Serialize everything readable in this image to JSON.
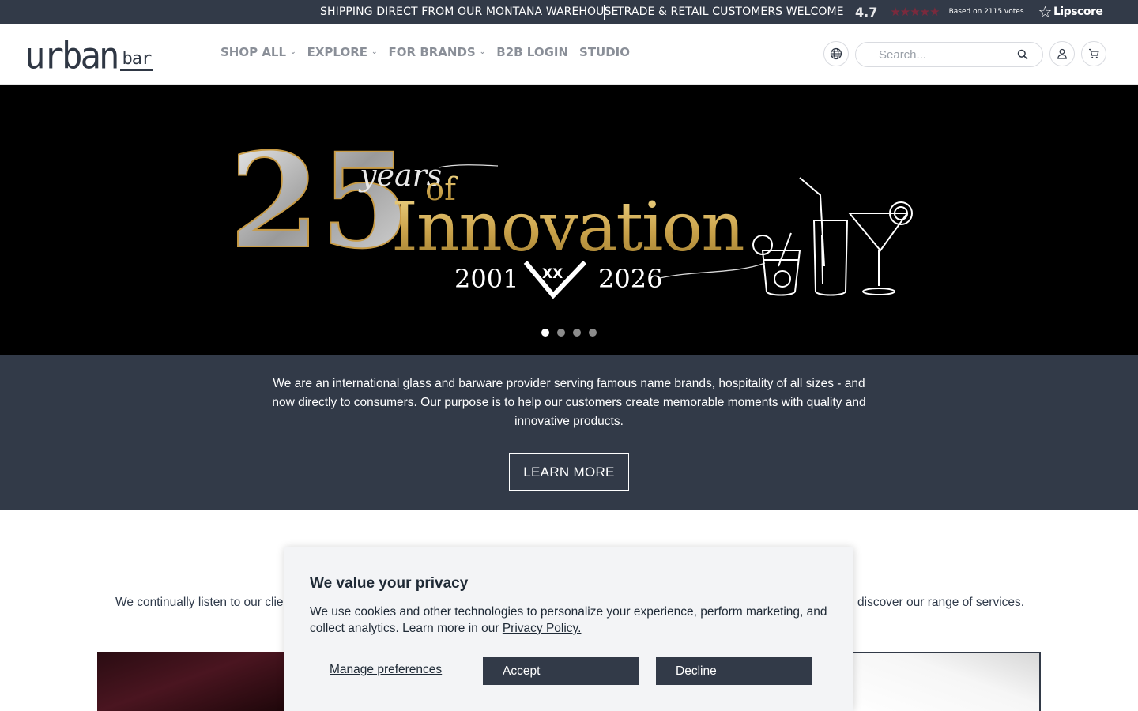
{
  "topbar": {
    "message_1": "SHIPPING DIRECT FROM OUR MONTANA WAREHOUSE",
    "message_2": "TRADE & RETAIL CUSTOMERS WELCOME",
    "rating_score": "4.7",
    "rating_stars": "★★★★★",
    "rating_votes": "Based on 2115 votes",
    "lipscore_brand": "Lipscore",
    "lipscore_star": "☆"
  },
  "header": {
    "logo_word": "urban",
    "logo_bar": "bar",
    "nav": [
      {
        "label": "SHOP ALL",
        "has_dropdown": true,
        "chevron": "⌄"
      },
      {
        "label": "EXPLORE",
        "has_dropdown": true,
        "chevron": "⌄"
      },
      {
        "label": "FOR BRANDS",
        "has_dropdown": true,
        "chevron": "⌄"
      },
      {
        "label": "B2B LOGIN",
        "has_dropdown": false
      },
      {
        "label": "STUDIO",
        "has_dropdown": false
      }
    ],
    "search_placeholder": "Search...",
    "icons": [
      "globe-icon",
      "search-icon",
      "user-icon",
      "cart-icon"
    ]
  },
  "hero": {
    "number": "25",
    "years": "years",
    "of": "of",
    "headline": "Innovation",
    "year_start": "2001",
    "emblem": "XX",
    "year_end": "2026",
    "slides_count": 4,
    "active_slide": 1
  },
  "about": {
    "text": "We are an international glass and barware provider serving famous name brands, hospitality of all sizes - and now directly to consumers. Our purpose is to help our customers create memorable moments with quality and innovative products.",
    "button_label": "LEARN MORE"
  },
  "services": {
    "text_left": "We continually listen to our clie",
    "text_right": "discover our range of services."
  },
  "cookie": {
    "title": "We value your privacy",
    "body": "We use cookies and other technologies to personalize your experience, perform marketing, and collect analytics. Learn more in our",
    "policy_link": "Privacy Policy.",
    "manage_label": "Manage preferences",
    "accept_label": "Accept",
    "decline_label": "Decline"
  },
  "colors": {
    "dark_slate": "#323a48",
    "gold": "#d4b15a",
    "nav_gray": "#8a8f98",
    "star_red": "#7a2a3d"
  }
}
